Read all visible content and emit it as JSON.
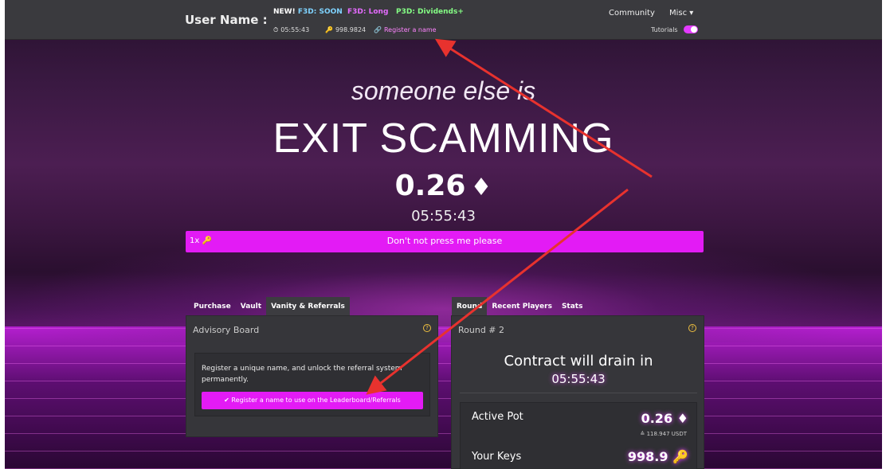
{
  "topbar": {
    "brand": "User Name :",
    "nav": {
      "new_prefix": "NEW!",
      "new_label": "F3D: SOON",
      "long_label": "F3D: Long",
      "dividends_label": "P3D: Dividends+"
    },
    "stats": {
      "timer": "05:55:43",
      "keys": "998.9824",
      "register": "Register a name"
    },
    "community": "Community",
    "misc": "Misc ▾",
    "tutorials": "Tutorials"
  },
  "hero": {
    "line1": "someone else is",
    "line2": "EXIT SCAMMING",
    "pot": "0.26",
    "timer": "05:55:43"
  },
  "buy": {
    "qty": "1x",
    "label": "Don't not press me please"
  },
  "left_panel": {
    "tabs": [
      "Purchase",
      "Vault",
      "Vanity & Referrals"
    ],
    "active_tab": 2,
    "header": "Advisory Board",
    "help": "?",
    "description": "Register a unique name, and unlock the referral system permanently.",
    "register_button": "✔ Register a name to use on the Leaderboard/Referrals"
  },
  "right_panel": {
    "tabs": [
      "Round",
      "Recent Players",
      "Stats"
    ],
    "active_tab": 0,
    "header": "Round # 2",
    "help": "?",
    "drain_text": "Contract will drain in",
    "drain_timer": "05:55:43",
    "active_pot_label": "Active Pot",
    "active_pot_value": "0.26",
    "usdt": "≙ 118.947 USDT",
    "keys_label": "Your Keys",
    "keys_value": "998.9"
  },
  "colors": {
    "accent": "#e31bf5",
    "topbar": "#3a3a3e",
    "panel": "#36363a",
    "arrow": "#e8322e"
  },
  "icons": [
    "stopwatch-icon",
    "key-icon",
    "link-icon",
    "ethereum-icon",
    "check-icon",
    "help-icon"
  ]
}
